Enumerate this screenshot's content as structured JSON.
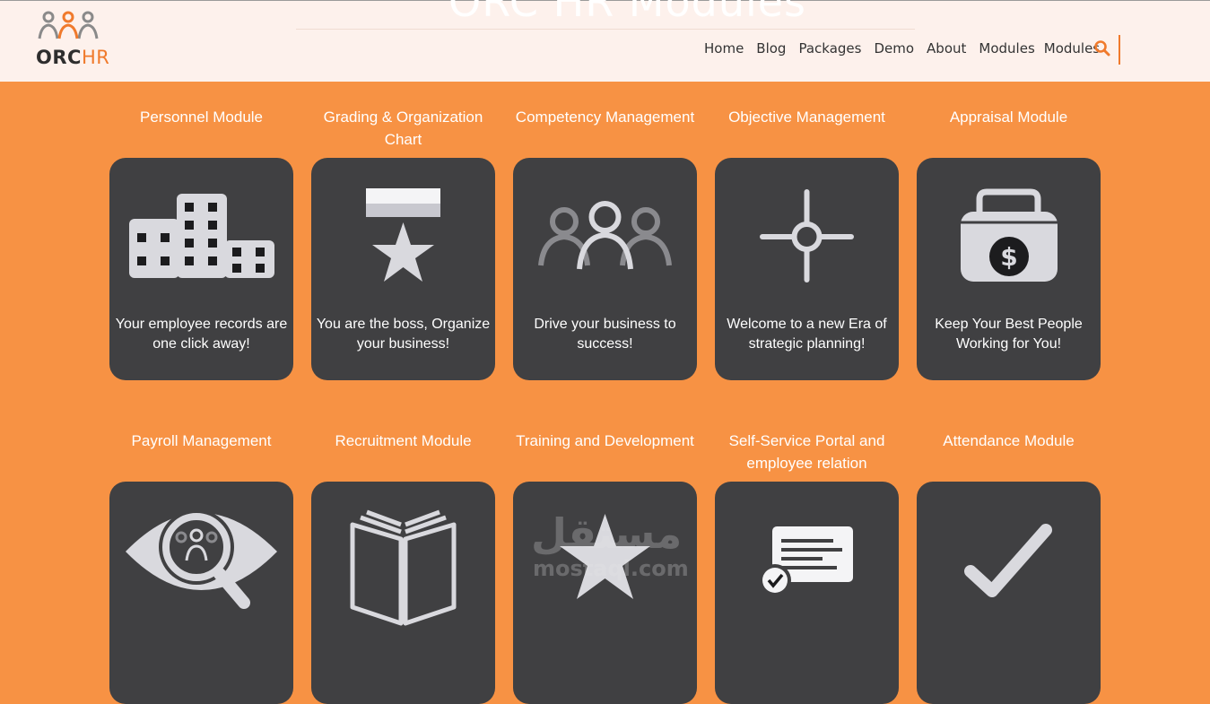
{
  "header": {
    "hero_title": "ORC HR Modules",
    "logo": {
      "brand": "ORC",
      "suffix": "HR"
    },
    "nav": [
      "Home",
      "Blog",
      "Packages",
      "Demo",
      "About",
      "Modules",
      "Modules"
    ],
    "search_icon": "search-icon",
    "accent": "#f07a2c"
  },
  "modules": [
    {
      "title": "Personnel Module",
      "desc": "Your employee records are one click away!",
      "icon": "buildings-icon"
    },
    {
      "title": "Grading & Organization Chart",
      "desc": "You are the boss, Organize your business!",
      "icon": "medal-icon"
    },
    {
      "title": "Competency Management",
      "desc": "Drive your business to success!",
      "icon": "team-icon"
    },
    {
      "title": "Objective Management",
      "desc": "Welcome to a new Era of strategic planning!",
      "icon": "crosshair-icon"
    },
    {
      "title": "Appraisal Module",
      "desc": "Keep Your Best People Working for You!",
      "icon": "money-bag-icon"
    },
    {
      "title": "Payroll Management",
      "desc": "",
      "icon": "eye-search-icon"
    },
    {
      "title": "Recruitment Module",
      "desc": "",
      "icon": "book-icon"
    },
    {
      "title": "Training and Development",
      "desc": "",
      "icon": "star-icon"
    },
    {
      "title": "Self-Service Portal and employee relation",
      "desc": "",
      "icon": "document-check-icon"
    },
    {
      "title": "Attendance Module",
      "desc": "",
      "icon": "checkmark-icon"
    }
  ],
  "watermark": {
    "arabic": "مستقل",
    "latin": "mostaql.com"
  },
  "colors": {
    "background": "#f79244",
    "card": "#404042",
    "header_bg": "#fdf1ec",
    "icon": "#d9d9de"
  }
}
